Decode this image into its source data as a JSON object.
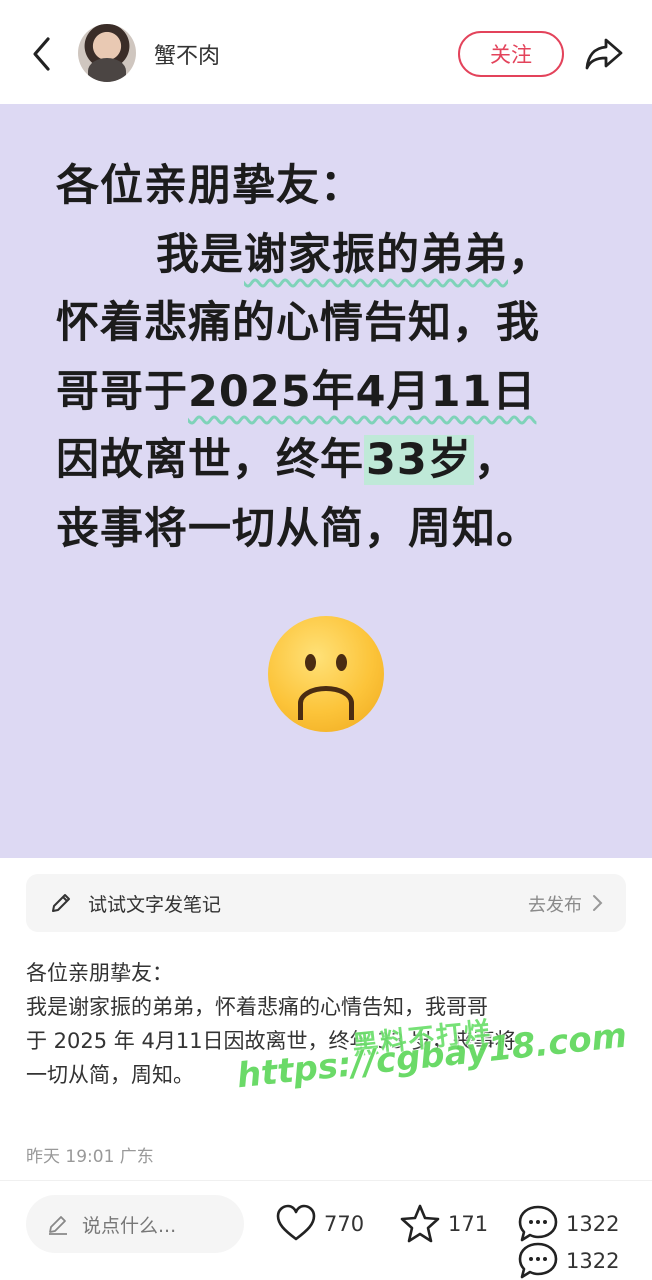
{
  "header": {
    "username": "蟹不肉",
    "follow_label": "关注"
  },
  "image_text": {
    "line1": "各位亲朋挚友：",
    "line2_a": "我是",
    "line2_b": "谢家振的弟弟",
    "line2_c": "，",
    "line3": "怀着悲痛的心情告知，我",
    "line4_a": "哥哥于",
    "line4_b": "2025年4月11日",
    "line5_a": "因故离世，终年",
    "line5_b": "33岁",
    "line5_c": "，",
    "line6": "丧事将一切从简，周知。"
  },
  "try_note": {
    "label": "试试文字发笔记",
    "publish": "去发布"
  },
  "post": {
    "line1": "各位亲朋挚友：",
    "line2": "我是谢家振的弟弟，怀着悲痛的心情告知，我哥哥",
    "line3": "于 2025 年 4月11日因故离世，终年 33 岁，丧事将",
    "line4": "一切从简，周知。",
    "meta": "昨天 19:01 广东"
  },
  "watermark": {
    "line1": "黑料不打烊",
    "line2": "https://cgbay18.com"
  },
  "bottom_bar": {
    "comment_placeholder": "说点什么...",
    "likes": "770",
    "collects": "171",
    "comments": "1322",
    "comments_repeat": "1322"
  },
  "colors": {
    "accent": "#e3435b",
    "image_bg": "#ddd9f3",
    "underline": "#7fd3b9",
    "watermark": "#64d960"
  },
  "icons": [
    "back-arrow-icon",
    "avatar",
    "share-icon",
    "pen-icon",
    "chevron-right-icon",
    "edit-icon",
    "heart-icon",
    "star-icon",
    "comment-bubble-icon",
    "sad-face-emoji"
  ]
}
